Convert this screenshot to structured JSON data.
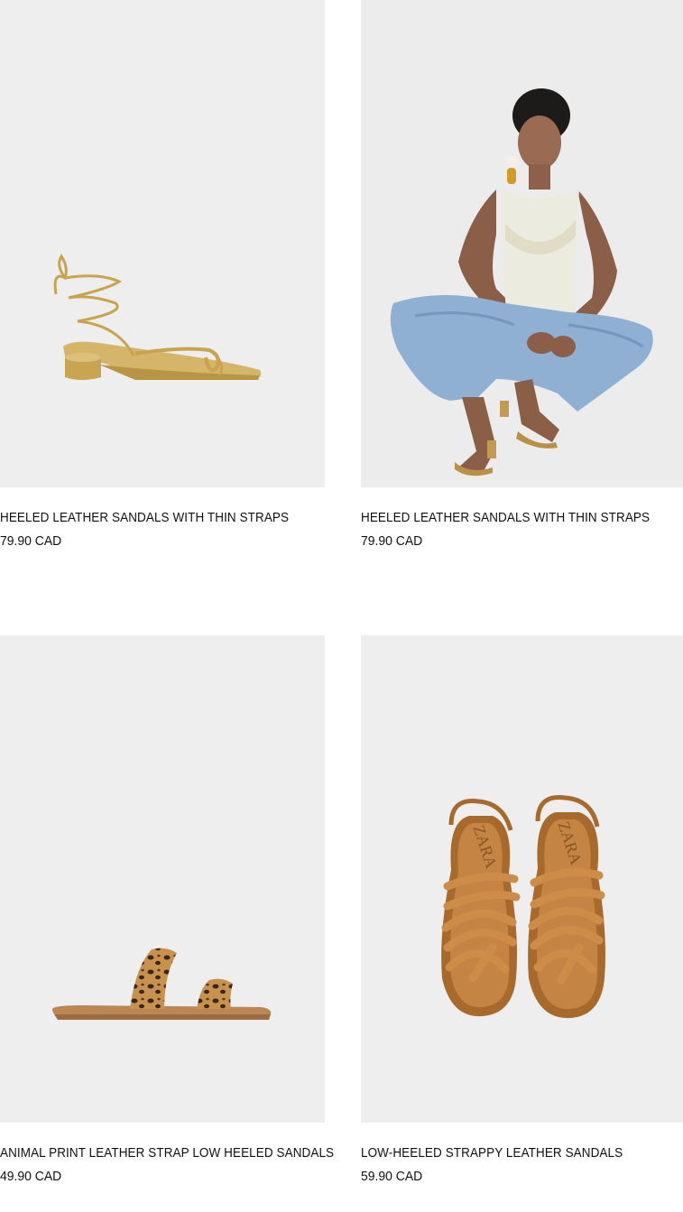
{
  "products": [
    {
      "name": "HEELED LEATHER SANDALS WITH THIN STRAPS",
      "price": "79.90 CAD",
      "image_icon": "gold-lace-up-sandal-image",
      "image_bg": "#eeeeee"
    },
    {
      "name": "HEELED LEATHER SANDALS WITH THIN STRAPS",
      "price": "79.90 CAD",
      "image_icon": "model-wearing-sandals-image",
      "image_bg": "#ececec"
    },
    {
      "name": "ANIMAL PRINT LEATHER STRAP LOW HEELED SANDALS",
      "price": "49.90 CAD",
      "image_icon": "leopard-slide-sandal-image",
      "image_bg": "#eeeeee"
    },
    {
      "name": "LOW-HEELED STRAPPY LEATHER SANDALS",
      "price": "59.90 CAD",
      "image_icon": "tan-strappy-sandals-image",
      "image_bg": "#eeeeee",
      "logo_text": "ZARA"
    }
  ]
}
